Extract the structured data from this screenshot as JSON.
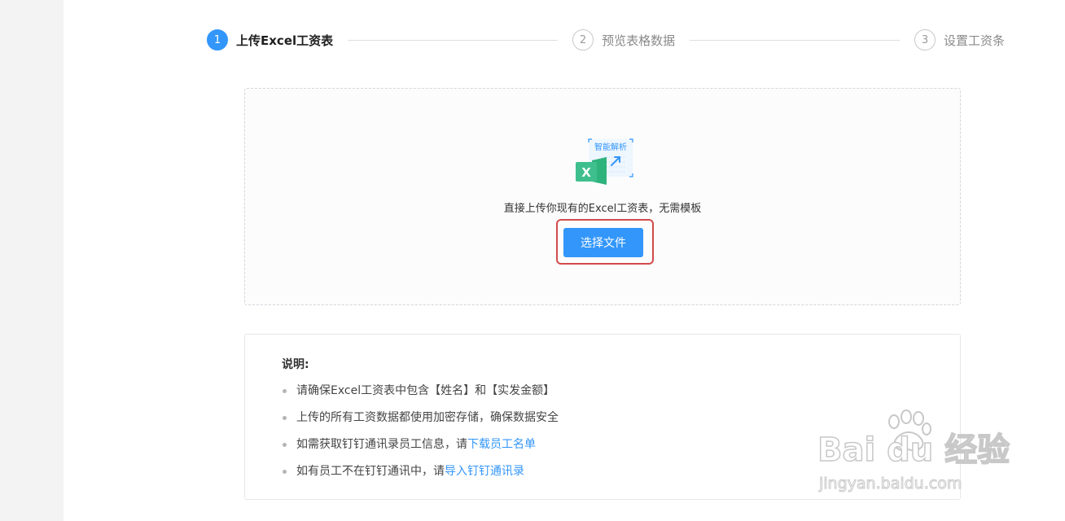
{
  "steps": [
    {
      "number": "1",
      "label": "上传Excel工资表",
      "active": true
    },
    {
      "number": "2",
      "label": "预览表格数据",
      "active": false
    },
    {
      "number": "3",
      "label": "设置工资条",
      "active": false
    }
  ],
  "upload": {
    "badge_text": "智能解析",
    "description": "直接上传你现有的Excel工资表，无需模板",
    "choose_button_label": "选择文件"
  },
  "notes": {
    "title": "说明:",
    "items": [
      {
        "text": "请确保Excel工资表中包含【姓名】和【实发金额】",
        "link": ""
      },
      {
        "text": "上传的所有工资数据都使用加密存储，确保数据安全",
        "link": ""
      },
      {
        "text": "如需获取钉钉通讯录员工信息，请 ",
        "link": "下载员工名单"
      },
      {
        "text": "如有员工不在钉钉通讯中，请 ",
        "link": "导入钉钉通讯录"
      }
    ]
  },
  "watermark": {
    "brand": "Bai du 经验",
    "url": "jingyan.baidu.com"
  },
  "colors": {
    "primary": "#3296fa",
    "highlight_frame": "#d24b4b",
    "excel_green": "#3fbf8e"
  },
  "icons": {
    "excel": "excel-file-icon",
    "arrow": "arrow-up-right-icon",
    "paw": "baidu-paw-icon"
  }
}
